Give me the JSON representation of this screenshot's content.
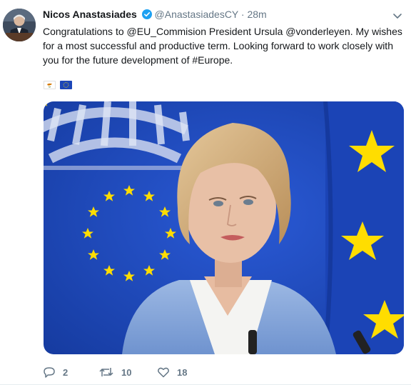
{
  "author": {
    "name": "Nicos Anastasiades",
    "handle": "@AnastasiadesCY",
    "separator": "·",
    "time": "28m"
  },
  "tweet": {
    "lines": [
      "Congratulations to @EU_Commision President Ursula @vonderleyen. My wishes",
      "for a most successful and productive term. Looking forward to work closely with",
      "you for the future development of #Europe."
    ]
  },
  "emoji": [
    "cyprus-flag",
    "eu-flag"
  ],
  "actions": {
    "replies": "2",
    "retweets": "10",
    "likes": "18"
  },
  "colors": {
    "eu_blue": "#1c46b8",
    "star_yellow": "#ffdd00",
    "jacket": "#86a9da",
    "muted": "#657786",
    "verified": "#1da1f2"
  }
}
